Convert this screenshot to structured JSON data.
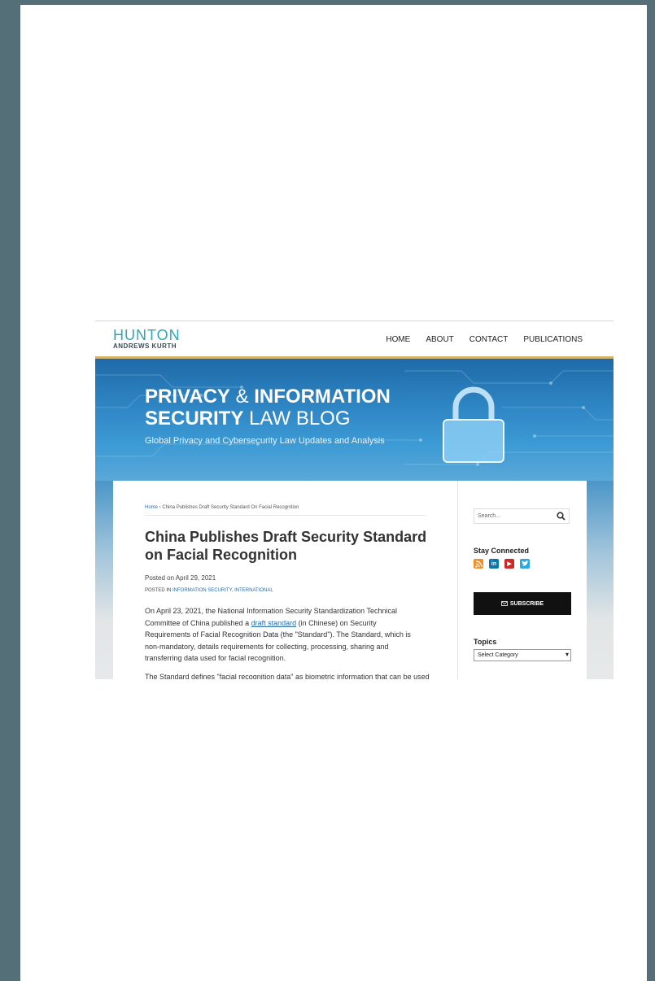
{
  "logo": {
    "main": "HUNTON",
    "sub": "ANDREWS KURTH"
  },
  "nav": [
    "HOME",
    "ABOUT",
    "CONTACT",
    "PUBLICATIONS"
  ],
  "banner": {
    "title_line1_bold": "PRIVACY",
    "title_line1_amp": " & ",
    "title_line1_bold2": "INFORMATION",
    "title_line2_bold": "SECURITY",
    "title_line2_rest": " LAW BLOG",
    "subtitle": "Global Privacy and Cybersecurity Law Updates and Analysis"
  },
  "breadcrumb": {
    "home": "Home",
    "sep": " › ",
    "current": "China Publishes Draft Security Standard On Facial Recognition"
  },
  "post": {
    "title": "China Publishes Draft Security Standard on Facial Recognition",
    "posted": "Posted on April 29, 2021",
    "posted_in_label": "POSTED IN ",
    "posted_in_categories": "INFORMATION SECURITY, INTERNATIONAL",
    "body_before_link": "On April 23, 2021, the National Information Security Standardization Technical Committee of China published a ",
    "body_link": "draft standard",
    "body_after_link": " (in Chinese) on Security Requirements of Facial Recognition Data (the \"Standard\"). The Standard, which is non-mandatory, details requirements for collecting, processing, sharing and transferring data used for facial recognition.",
    "body_2": "The Standard defines \"facial recognition data\" as biometric information that can be used"
  },
  "sidebar": {
    "search_placeholder": "Search...",
    "stay_connected": "Stay Connected",
    "social_icons": [
      "rss-icon",
      "linkedin-icon",
      "youtube-icon",
      "twitter-icon"
    ],
    "subscribe": "SUBSCRIBE",
    "topics": "Topics",
    "select_category": "Select Category"
  },
  "colors": {
    "accent": "#2aa7b8",
    "gold": "#d3b46a",
    "link": "#2a6ea9",
    "background": "#546f78"
  }
}
